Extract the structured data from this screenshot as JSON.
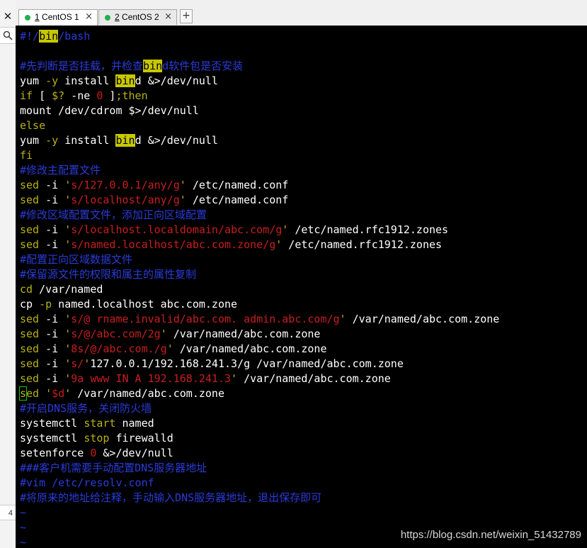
{
  "colors": {
    "comment": "#2a3bd8",
    "command": "#ffffff",
    "keyword": "#b8b01a",
    "string": "#c81e1e",
    "search_highlight": "#c8c800",
    "tilde": "#2a3bd8",
    "tab_active_dot": "#22b14c"
  },
  "left_panel": {
    "close_glyph": "✕",
    "search_icon": "search-icon",
    "number": "4"
  },
  "tabs": [
    {
      "prefix": "1",
      "label": " CentOS 1",
      "close": "×",
      "active": true
    },
    {
      "prefix": "2",
      "label": " CentOS 2",
      "close": "×",
      "active": false
    }
  ],
  "new_tab_label": "+",
  "terminal_lines": [
    [
      [
        "comment",
        "#!/"
      ],
      [
        "comment_hl",
        "bin"
      ],
      [
        "comment",
        "/bash"
      ]
    ],
    [],
    [
      [
        "comment",
        "#先判断是否挂载，并检查"
      ],
      [
        "comment_hl",
        "bin"
      ],
      [
        "comment",
        "d软件包是否安装"
      ]
    ],
    [
      [
        "command",
        "yum "
      ],
      [
        "keyword",
        "-y"
      ],
      [
        "command",
        " install "
      ],
      [
        "hl",
        "bin"
      ],
      [
        "command",
        "d &>/dev/null"
      ]
    ],
    [
      [
        "keyword",
        "if"
      ],
      [
        "command",
        " [ "
      ],
      [
        "keyword",
        "$?"
      ],
      [
        "command",
        " -ne "
      ],
      [
        "string",
        "0"
      ],
      [
        "command",
        " ]"
      ],
      [
        "keyword",
        ";then"
      ]
    ],
    [
      [
        "command",
        "mount /dev/cdrom $>/dev/null"
      ]
    ],
    [
      [
        "keyword",
        "else"
      ]
    ],
    [
      [
        "command",
        "yum "
      ],
      [
        "keyword",
        "-y"
      ],
      [
        "command",
        " install "
      ],
      [
        "hl",
        "bin"
      ],
      [
        "command",
        "d &>/dev/null"
      ]
    ],
    [
      [
        "keyword",
        "fi"
      ]
    ],
    [
      [
        "comment",
        "#修改主配置文件"
      ]
    ],
    [
      [
        "keyword",
        "sed"
      ],
      [
        "command",
        " -i "
      ],
      [
        "keyword",
        "'"
      ],
      [
        "string",
        "s/127.0.0.1/any/g"
      ],
      [
        "keyword",
        "'"
      ],
      [
        "command",
        " /etc/named.conf"
      ]
    ],
    [
      [
        "keyword",
        "sed"
      ],
      [
        "command",
        " -i "
      ],
      [
        "keyword",
        "'"
      ],
      [
        "string",
        "s/localhost/any/g"
      ],
      [
        "keyword",
        "'"
      ],
      [
        "command",
        " /etc/named.conf"
      ]
    ],
    [
      [
        "comment",
        "#修改区域配置文件，添加正向区域配置"
      ]
    ],
    [
      [
        "keyword",
        "sed"
      ],
      [
        "command",
        " -i "
      ],
      [
        "keyword",
        "'"
      ],
      [
        "string",
        "s/localhost.localdomain/abc.com/g"
      ],
      [
        "keyword",
        "'"
      ],
      [
        "command",
        " /etc/named.rfc1912.zones"
      ]
    ],
    [
      [
        "keyword",
        "sed"
      ],
      [
        "command",
        " -i "
      ],
      [
        "keyword",
        "'"
      ],
      [
        "string",
        "s/named.localhost/abc.com.zone/g"
      ],
      [
        "keyword",
        "'"
      ],
      [
        "command",
        " /etc/named.rfc1912.zones"
      ]
    ],
    [
      [
        "comment",
        "#配置正向区域数据文件"
      ]
    ],
    [
      [
        "comment",
        "#保留源文件的权限和属主的属性复制"
      ]
    ],
    [
      [
        "keyword",
        "cd"
      ],
      [
        "command",
        " /var/named"
      ]
    ],
    [
      [
        "command",
        "cp "
      ],
      [
        "keyword",
        "-p"
      ],
      [
        "command",
        " named.localhost abc.com.zone"
      ]
    ],
    [
      [
        "keyword",
        "sed"
      ],
      [
        "command",
        " -i "
      ],
      [
        "keyword",
        "'"
      ],
      [
        "string",
        "s/@ rname.invalid/abc.com. admin.abc.com/g"
      ],
      [
        "keyword",
        "'"
      ],
      [
        "command",
        " /var/named/abc.com.zone"
      ]
    ],
    [
      [
        "keyword",
        "sed"
      ],
      [
        "command",
        " -i "
      ],
      [
        "keyword",
        "'"
      ],
      [
        "string",
        "s/@/abc.com/2g"
      ],
      [
        "keyword",
        "'"
      ],
      [
        "command",
        " /var/named/abc.com.zone"
      ]
    ],
    [
      [
        "keyword",
        "sed"
      ],
      [
        "command",
        " -i "
      ],
      [
        "keyword",
        "'"
      ],
      [
        "string",
        "8s/@/abc.com./g"
      ],
      [
        "keyword",
        "'"
      ],
      [
        "command",
        " /var/named/abc.com.zone"
      ]
    ],
    [
      [
        "keyword",
        "sed"
      ],
      [
        "command",
        " -i "
      ],
      [
        "keyword",
        "'"
      ],
      [
        "string",
        "s/"
      ],
      [
        "keyword",
        "'"
      ],
      [
        "command",
        "127.0.0.1/192.168.241.3/g /var/named/abc.com.zone"
      ]
    ],
    [
      [
        "keyword",
        "sed"
      ],
      [
        "command",
        " -i "
      ],
      [
        "keyword",
        "'"
      ],
      [
        "string",
        "9a www IN A 192.168.241.3"
      ],
      [
        "keyword",
        "'"
      ],
      [
        "command",
        " /var/named/abc.com.zone"
      ]
    ],
    [
      [
        "cursor_keyword",
        "s"
      ],
      [
        "keyword",
        "ed"
      ],
      [
        "command",
        " "
      ],
      [
        "keyword",
        "'"
      ],
      [
        "string",
        "$d"
      ],
      [
        "keyword",
        "'"
      ],
      [
        "command",
        " /var/named/abc.com.zone"
      ]
    ],
    [
      [
        "comment",
        "#开启DNS服务，关闭防火墙"
      ]
    ],
    [
      [
        "command",
        "systemctl "
      ],
      [
        "keyword",
        "start"
      ],
      [
        "command",
        " named"
      ]
    ],
    [
      [
        "command",
        "systemctl "
      ],
      [
        "keyword",
        "stop"
      ],
      [
        "command",
        " firewalld"
      ]
    ],
    [
      [
        "command",
        "setenforce "
      ],
      [
        "string",
        "0"
      ],
      [
        "command",
        " &>/dev/null"
      ]
    ],
    [
      [
        "comment",
        "###客户机需要手动配置DNS服务器地址"
      ]
    ],
    [
      [
        "comment",
        "#vim /etc/resolv.conf"
      ]
    ],
    [
      [
        "comment",
        "#将原来的地址给注释，手动输入DNS服务器地址，退出保存即可"
      ]
    ],
    [
      [
        "tilde",
        "~"
      ]
    ],
    [
      [
        "tilde",
        "~"
      ]
    ],
    [
      [
        "tilde",
        "~"
      ]
    ]
  ],
  "watermark": "https://blog.csdn.net/weixin_51432789"
}
